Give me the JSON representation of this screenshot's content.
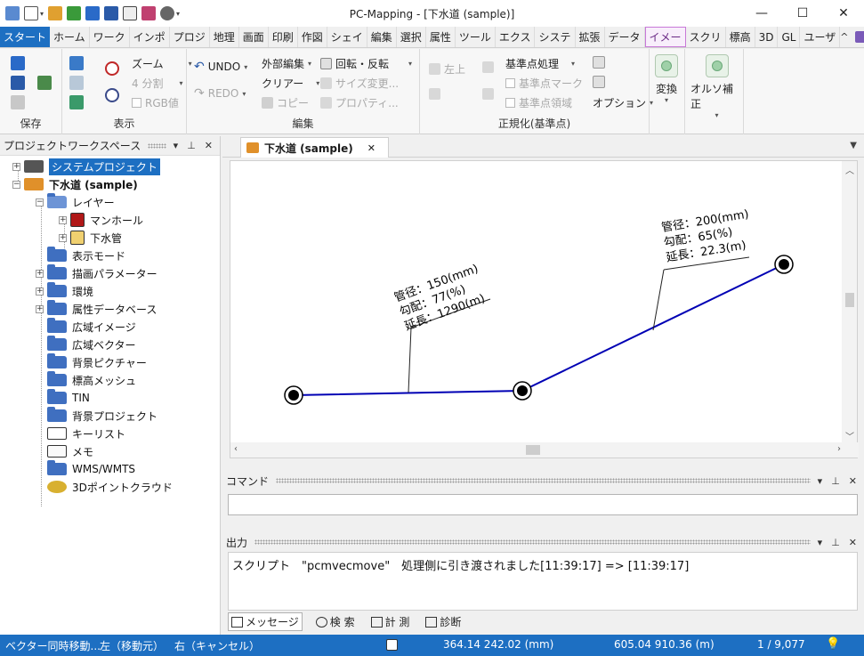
{
  "window": {
    "title": "PC-Mapping - [下水道 (sample)]",
    "minimize": "—",
    "maximize": "☐",
    "close": "✕"
  },
  "ribbon_tabs": [
    "スタート",
    "ホーム",
    "ワーク",
    "インポ",
    "プロジ",
    "地理",
    "画面",
    "印刷",
    "作図",
    "シェイ",
    "編集",
    "選択",
    "属性",
    "ツール",
    "エクス",
    "システ",
    "拡張",
    "データ",
    "イメー",
    "スクリ",
    "標高",
    "3D",
    "GL",
    "ユーザ"
  ],
  "ribbon_right": {
    "collapse": "^",
    "restore": "🗗",
    "close": "✕"
  },
  "ribbon": {
    "groups": {
      "save": "保存",
      "display": "表示",
      "edit": "編集",
      "normalize": "正規化(基準点)"
    },
    "display": {
      "zoom": "ズーム",
      "split": "4 分割",
      "rgb": "RGB値"
    },
    "edit": {
      "undo": "UNDO",
      "redo": "REDO",
      "external_edit": "外部編集",
      "clear": "クリアー",
      "copy": "コピー",
      "rotate_flip": "回転・反転",
      "size_change": "サイズ変更...",
      "property": "プロパティ..."
    },
    "normalize": {
      "align_left": "左上",
      "base_point_process": "基準点処理",
      "base_point_mark": "基準点マーク",
      "base_point_area": "基準点領域",
      "option": "オプション"
    },
    "convert": "変換",
    "ortho": "オルソ補正"
  },
  "left_pane": {
    "title": "プロジェクトワークスペース",
    "tree": {
      "system_project": "システムプロジェクト",
      "project": "下水道 (sample)",
      "layer": "レイヤー",
      "manhole": "マンホール",
      "sewer_pipe": "下水管",
      "display_mode": "表示モード",
      "draw_params": "描画パラメーター",
      "environment": "環境",
      "attr_db": "属性データベース",
      "wide_image": "広域イメージ",
      "wide_vector": "広域ベクター",
      "bg_picture": "背景ピクチャー",
      "elevation_mesh": "標高メッシュ",
      "tin": "TIN",
      "bg_project": "背景プロジェクト",
      "key_list": "キーリスト",
      "memo": "メモ",
      "wms": "WMS/WMTS",
      "pointcloud": "3Dポイントクラウド"
    }
  },
  "document_tab": {
    "label": "下水道 (sample)",
    "close": "✕"
  },
  "map": {
    "label1": {
      "line1": "管径：150(mm)",
      "line2": "勾配：77(%)",
      "line3": "延長：1290(m)"
    },
    "label2": {
      "line1": "管径：200(mm)",
      "line2": "勾配：65(%)",
      "line3": "延長：22.3(m)"
    },
    "line_color": "#0000b4"
  },
  "command_pane": {
    "title": "コマンド"
  },
  "output_pane": {
    "title": "出力",
    "message": "スクリプト　\"pcmvecmove\"　処理側に引き渡されました[11:39:17] => [11:39:17]",
    "tabs": {
      "message": "メッセージ",
      "search": "検 索",
      "measure": "計 測",
      "diagnose": "診断"
    }
  },
  "status": {
    "mode": "ベクター同時移動...",
    "left": "左（移動元）",
    "right": "右（キャンセル）",
    "coord1": "364.14 242.02 (mm)",
    "coord2": "605.04 910.36 (m)",
    "scale": "1 / 9,077"
  }
}
